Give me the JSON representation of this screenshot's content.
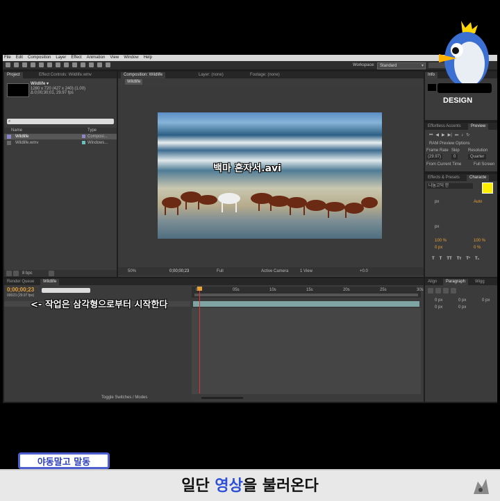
{
  "menu": [
    "File",
    "Edit",
    "Composition",
    "Layer",
    "Effect",
    "Animation",
    "View",
    "Window",
    "Help"
  ],
  "workspace": {
    "label": "Workspace:",
    "value": "Standard"
  },
  "project_panel": {
    "tab": "Project",
    "effect_tab": "Effect Controls: Wildlife.wmv",
    "item_name": "Wildlife ▾",
    "item_info1": "1280 x 720  (427 x 240) (1.00)",
    "item_info2": "Δ 0;00;30;01, 29.97 fps",
    "col_name": "Name",
    "col_type": "Type",
    "rows": [
      {
        "name": "Wildlife",
        "type": "Composi..."
      },
      {
        "name": "Wildlife.wmv",
        "type": "Windows..."
      }
    ],
    "bpc": "8 bpc"
  },
  "comp_panel": {
    "tab": "Composition: Wildlife",
    "layer_tab": "Layer: (none)",
    "footage_tab": "Footage: (none)",
    "sub_tab": "Wildlife",
    "zoom": "50%",
    "timecode": "0;00;00;23",
    "res": "Full",
    "camera": "Active Camera",
    "view": "1 View",
    "exposure": "+0.0"
  },
  "video_caption": "백마 혼자서.avi",
  "right_panels": {
    "info_tab": "Info",
    "preview_tab": "Effortless Accents",
    "preview_tab2": "Preview",
    "ram_preview": "RAM Preview Options",
    "frame_rate_label": "Frame Rate",
    "skip_label": "Skip",
    "resolution_label": "Resolution",
    "frame_rate": "(29.97)",
    "skip": "0",
    "resolution": "Quarter",
    "from_current": "From Current Time",
    "full_screen": "Full Screen",
    "effects_tab": "Effects & Presets",
    "character_tab": "Characte",
    "font_value": "나눔고딕 한",
    "px_label": "px",
    "auto_label": "Auto",
    "pct1": "100 %",
    "pct2": "100 %",
    "px2": "0 px",
    "pct3": "0 %",
    "align_tab": "Align",
    "paragraph_tab": "Paragraph",
    "wiggle_tab": "Wigg",
    "para_vals": [
      "0 px",
      "0 px",
      "0 px",
      "0 px",
      "0 px"
    ],
    "accent_color": "#ffee00"
  },
  "timeline": {
    "render_tab": "Render Queue",
    "comp_tab": "Wildlife",
    "timecode": "0;00;00;23",
    "frames": "00023 (29.97 fps)",
    "ticks": [
      "0s",
      "05s",
      "10s",
      "15s",
      "20s",
      "25s",
      "30s"
    ],
    "toggle_label": "Toggle Switches / Modes",
    "annotation": "<- 작업은 삼각형으로부터 시작한다"
  },
  "logo": {
    "label": "DESIGN"
  },
  "footer": {
    "badge": "야동말고 말동",
    "caption_pre": "일단 ",
    "caption_highlight": "영상",
    "caption_post": "을 불러온다"
  }
}
